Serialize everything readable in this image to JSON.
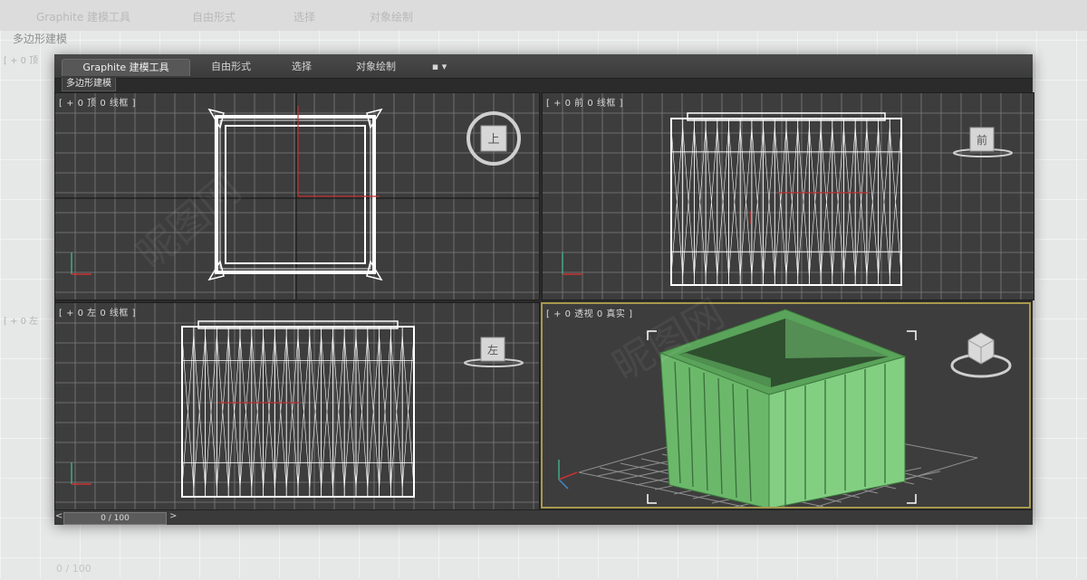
{
  "ribbon": {
    "tabs": [
      {
        "label": "Graphite 建模工具"
      },
      {
        "label": "自由形式"
      },
      {
        "label": "选择"
      },
      {
        "label": "对象绘制"
      },
      {
        "label": "▪ ▾"
      }
    ],
    "subtab": "多边形建模"
  },
  "background": {
    "tabs": [
      "Graphite 建模工具",
      "自由形式",
      "选择",
      "对象绘制"
    ],
    "subtab": "多边形建模",
    "label_top": "[ + 0 顶",
    "label_left": "[ + 0 左",
    "time": "0 / 100"
  },
  "viewports": {
    "top": {
      "label": "[ + 0 顶 0 线框 ]",
      "cube": "上"
    },
    "front": {
      "label": "[ + 0 前 0 线框 ]",
      "cube": "前"
    },
    "left": {
      "label": "[ + 0 左 0 线框 ]",
      "cube": "左"
    },
    "perspective": {
      "label": "[ + 0 透视 0 真实 ]"
    }
  },
  "timeline": {
    "value": "0 / 100",
    "prev": "<",
    "next": ">"
  },
  "colors": {
    "accent": "#a8994f",
    "object": "#7bc77b",
    "wire": "#ffffff",
    "grid": "#8a8a8a"
  },
  "watermark": "昵图网"
}
